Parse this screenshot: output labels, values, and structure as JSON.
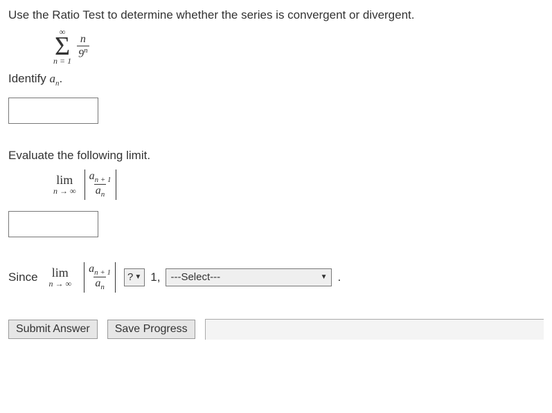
{
  "problem": {
    "instruction": "Use the Ratio Test to determine whether the series is convergent or divergent.",
    "series_top": "∞",
    "series_bottom": "n = 1",
    "series_numerator": "n",
    "series_denominator_base": "9",
    "series_denominator_exp": "n"
  },
  "identify": {
    "label_prefix": "Identify ",
    "label_a": "a",
    "label_sub": "n",
    "label_suffix": "."
  },
  "limit_section": {
    "prompt": "Evaluate the following limit.",
    "lim": "lim",
    "lim_sub": "n → ∞",
    "ratio_num_a": "a",
    "ratio_num_sub": "n + 1",
    "ratio_den_a": "a",
    "ratio_den_sub": "n"
  },
  "since": {
    "label": "Since",
    "question_symbol": "?",
    "one_label": "1,",
    "select_label": "---Select---",
    "period": "."
  },
  "buttons": {
    "submit": "Submit Answer",
    "save": "Save Progress"
  },
  "inputs": {
    "an_value": "",
    "limit_value": ""
  }
}
